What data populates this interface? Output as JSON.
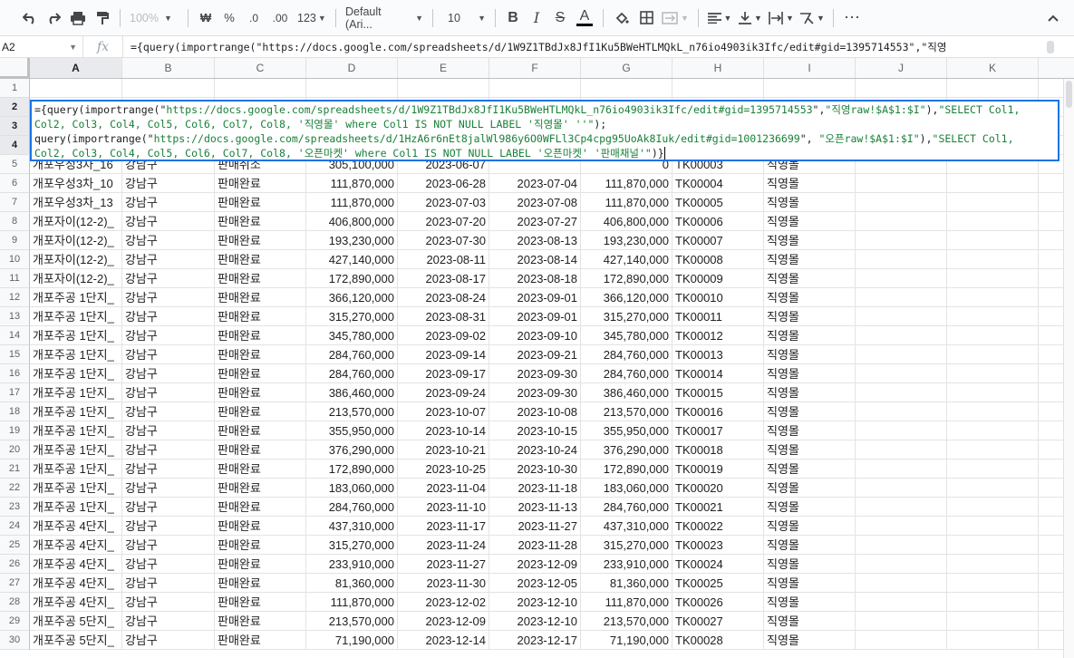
{
  "toolbar": {
    "zoom": "100%",
    "currency": "₩",
    "percent": "%",
    "dec_decrease": ".0",
    "dec_increase": ".00",
    "more_formats": "123",
    "font": "Default (Ari...",
    "font_size": "10",
    "bold": "B",
    "italic": "I",
    "strike": "S",
    "text_color": "A",
    "more": "⋮"
  },
  "formula_bar": {
    "cell_ref": "A2",
    "fx": "fx",
    "content": "={query(importrange(\"https://docs.google.com/spreadsheets/d/1W9Z1TBdJx8JfI1Ku5BWeHTLMQkL_n76io4903ik3Ifc/edit#gid=1395714553\",\"직영"
  },
  "columns": [
    "A",
    "B",
    "C",
    "D",
    "E",
    "F",
    "G",
    "H",
    "I",
    "J",
    "K"
  ],
  "editor": {
    "line1a": "={query(importrange(\"",
    "line1b": "https://docs.google.com/spreadsheets/d/1W9Z1TBdJx8JfI1Ku5BWeHTLMQkL_n76io4903ik3Ifc/edit#gid=1395714553",
    "line1c": "\",",
    "line1d": "\"직영raw!$A$1:$I\"",
    "line1e": "),",
    "line1f": "\"SELECT Col1,",
    "line2a": "Col2, Col3, Col4, Col5, Col6, Col7, Col8, '직영몰' where Col1 IS NOT NULL LABEL '직영몰' ''\"",
    "line2b": ");",
    "line3a": "query(importrange(\"",
    "line3b": "https://docs.google.com/spreadsheets/d/1HzA6r6nEt8jalWl986y6O0WFLl3Cp4cpg95UoAk8Iuk/edit#gid=1001236699",
    "line3c": "\", ",
    "line3d": "\"오픈raw!$A$1:$I\"",
    "line3e": "),",
    "line3f": "\"SELECT Col1,",
    "line4a": "Col2, Col3, Col4, Col5, Col6, Col7, Col8, '오픈마켓' where Col1 IS NOT NULL LABEL '오픈마켓' '판매채널'\"",
    "line4b": ")}"
  },
  "rows": [
    {
      "n": "1",
      "a": "",
      "b": "",
      "c": "",
      "d": "",
      "e": "",
      "f": "",
      "g": "",
      "h": "",
      "i": ""
    },
    {
      "n": "2",
      "a": "",
      "b": "",
      "c": "",
      "d": "",
      "e": "",
      "f": "",
      "g": "",
      "h": "",
      "i": ""
    },
    {
      "n": "3",
      "a": "",
      "b": "",
      "c": "",
      "d": "",
      "e": "",
      "f": "",
      "g": "",
      "h": "",
      "i": ""
    },
    {
      "n": "4",
      "a": "",
      "b": "",
      "c": "",
      "d": "",
      "e": "",
      "f": "",
      "g": "",
      "h": "",
      "i": ""
    },
    {
      "n": "5",
      "a": "개포우성3차_16",
      "b": "강남구",
      "c": "판매취소",
      "d": "305,100,000",
      "e": "2023-06-07",
      "f": "",
      "g": "0",
      "h": "TK00003",
      "i": "직영몰"
    },
    {
      "n": "6",
      "a": "개포우성3차_10",
      "b": "강남구",
      "c": "판매완료",
      "d": "111,870,000",
      "e": "2023-06-28",
      "f": "2023-07-04",
      "g": "111,870,000",
      "h": "TK00004",
      "i": "직영몰"
    },
    {
      "n": "7",
      "a": "개포우성3차_13",
      "b": "강남구",
      "c": "판매완료",
      "d": "111,870,000",
      "e": "2023-07-03",
      "f": "2023-07-08",
      "g": "111,870,000",
      "h": "TK00005",
      "i": "직영몰"
    },
    {
      "n": "8",
      "a": "개포자이(12-2)_",
      "b": "강남구",
      "c": "판매완료",
      "d": "406,800,000",
      "e": "2023-07-20",
      "f": "2023-07-27",
      "g": "406,800,000",
      "h": "TK00006",
      "i": "직영몰"
    },
    {
      "n": "9",
      "a": "개포자이(12-2)_",
      "b": "강남구",
      "c": "판매완료",
      "d": "193,230,000",
      "e": "2023-07-30",
      "f": "2023-08-13",
      "g": "193,230,000",
      "h": "TK00007",
      "i": "직영몰"
    },
    {
      "n": "10",
      "a": "개포자이(12-2)_",
      "b": "강남구",
      "c": "판매완료",
      "d": "427,140,000",
      "e": "2023-08-11",
      "f": "2023-08-14",
      "g": "427,140,000",
      "h": "TK00008",
      "i": "직영몰"
    },
    {
      "n": "11",
      "a": "개포자이(12-2)_",
      "b": "강남구",
      "c": "판매완료",
      "d": "172,890,000",
      "e": "2023-08-17",
      "f": "2023-08-18",
      "g": "172,890,000",
      "h": "TK00009",
      "i": "직영몰"
    },
    {
      "n": "12",
      "a": "개포주공 1단지_",
      "b": "강남구",
      "c": "판매완료",
      "d": "366,120,000",
      "e": "2023-08-24",
      "f": "2023-09-01",
      "g": "366,120,000",
      "h": "TK00010",
      "i": "직영몰"
    },
    {
      "n": "13",
      "a": "개포주공 1단지_",
      "b": "강남구",
      "c": "판매완료",
      "d": "315,270,000",
      "e": "2023-08-31",
      "f": "2023-09-01",
      "g": "315,270,000",
      "h": "TK00011",
      "i": "직영몰"
    },
    {
      "n": "14",
      "a": "개포주공 1단지_",
      "b": "강남구",
      "c": "판매완료",
      "d": "345,780,000",
      "e": "2023-09-02",
      "f": "2023-09-10",
      "g": "345,780,000",
      "h": "TK00012",
      "i": "직영몰"
    },
    {
      "n": "15",
      "a": "개포주공 1단지_",
      "b": "강남구",
      "c": "판매완료",
      "d": "284,760,000",
      "e": "2023-09-14",
      "f": "2023-09-21",
      "g": "284,760,000",
      "h": "TK00013",
      "i": "직영몰"
    },
    {
      "n": "16",
      "a": "개포주공 1단지_",
      "b": "강남구",
      "c": "판매완료",
      "d": "284,760,000",
      "e": "2023-09-17",
      "f": "2023-09-30",
      "g": "284,760,000",
      "h": "TK00014",
      "i": "직영몰"
    },
    {
      "n": "17",
      "a": "개포주공 1단지_",
      "b": "강남구",
      "c": "판매완료",
      "d": "386,460,000",
      "e": "2023-09-24",
      "f": "2023-09-30",
      "g": "386,460,000",
      "h": "TK00015",
      "i": "직영몰"
    },
    {
      "n": "18",
      "a": "개포주공 1단지_",
      "b": "강남구",
      "c": "판매완료",
      "d": "213,570,000",
      "e": "2023-10-07",
      "f": "2023-10-08",
      "g": "213,570,000",
      "h": "TK00016",
      "i": "직영몰"
    },
    {
      "n": "19",
      "a": "개포주공 1단지_",
      "b": "강남구",
      "c": "판매완료",
      "d": "355,950,000",
      "e": "2023-10-14",
      "f": "2023-10-15",
      "g": "355,950,000",
      "h": "TK00017",
      "i": "직영몰"
    },
    {
      "n": "20",
      "a": "개포주공 1단지_",
      "b": "강남구",
      "c": "판매완료",
      "d": "376,290,000",
      "e": "2023-10-21",
      "f": "2023-10-24",
      "g": "376,290,000",
      "h": "TK00018",
      "i": "직영몰"
    },
    {
      "n": "21",
      "a": "개포주공 1단지_",
      "b": "강남구",
      "c": "판매완료",
      "d": "172,890,000",
      "e": "2023-10-25",
      "f": "2023-10-30",
      "g": "172,890,000",
      "h": "TK00019",
      "i": "직영몰"
    },
    {
      "n": "22",
      "a": "개포주공 1단지_",
      "b": "강남구",
      "c": "판매완료",
      "d": "183,060,000",
      "e": "2023-11-04",
      "f": "2023-11-18",
      "g": "183,060,000",
      "h": "TK00020",
      "i": "직영몰"
    },
    {
      "n": "23",
      "a": "개포주공 1단지_",
      "b": "강남구",
      "c": "판매완료",
      "d": "284,760,000",
      "e": "2023-11-10",
      "f": "2023-11-13",
      "g": "284,760,000",
      "h": "TK00021",
      "i": "직영몰"
    },
    {
      "n": "24",
      "a": "개포주공 4단지_",
      "b": "강남구",
      "c": "판매완료",
      "d": "437,310,000",
      "e": "2023-11-17",
      "f": "2023-11-27",
      "g": "437,310,000",
      "h": "TK00022",
      "i": "직영몰"
    },
    {
      "n": "25",
      "a": "개포주공 4단지_",
      "b": "강남구",
      "c": "판매완료",
      "d": "315,270,000",
      "e": "2023-11-24",
      "f": "2023-11-28",
      "g": "315,270,000",
      "h": "TK00023",
      "i": "직영몰"
    },
    {
      "n": "26",
      "a": "개포주공 4단지_",
      "b": "강남구",
      "c": "판매완료",
      "d": "233,910,000",
      "e": "2023-11-27",
      "f": "2023-12-09",
      "g": "233,910,000",
      "h": "TK00024",
      "i": "직영몰"
    },
    {
      "n": "27",
      "a": "개포주공 4단지_",
      "b": "강남구",
      "c": "판매완료",
      "d": "81,360,000",
      "e": "2023-11-30",
      "f": "2023-12-05",
      "g": "81,360,000",
      "h": "TK00025",
      "i": "직영몰"
    },
    {
      "n": "28",
      "a": "개포주공 4단지_",
      "b": "강남구",
      "c": "판매완료",
      "d": "111,870,000",
      "e": "2023-12-02",
      "f": "2023-12-10",
      "g": "111,870,000",
      "h": "TK00026",
      "i": "직영몰"
    },
    {
      "n": "29",
      "a": "개포주공 5단지_",
      "b": "강남구",
      "c": "판매완료",
      "d": "213,570,000",
      "e": "2023-12-09",
      "f": "2023-12-10",
      "g": "213,570,000",
      "h": "TK00027",
      "i": "직영몰"
    },
    {
      "n": "30",
      "a": "개포주공 5단지_",
      "b": "강남구",
      "c": "판매완료",
      "d": "71,190,000",
      "e": "2023-12-14",
      "f": "2023-12-17",
      "g": "71,190,000",
      "h": "TK00028",
      "i": "직영몰"
    }
  ]
}
